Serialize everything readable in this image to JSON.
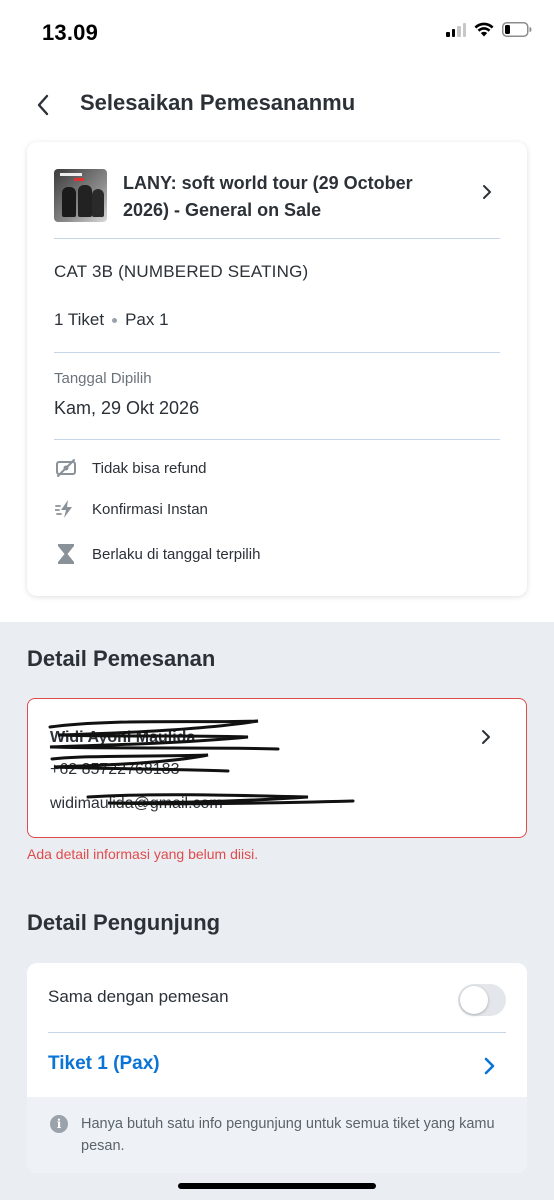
{
  "status_bar": {
    "time": "13.09"
  },
  "header": {
    "title": "Selesaikan Pemesananmu"
  },
  "event": {
    "title": "LANY: soft world tour (29 October 2026) - General on Sale",
    "category": "CAT 3B (NUMBERED SEATING)",
    "ticket_count": "1 Tiket",
    "pax": "Pax 1",
    "date_label": "Tanggal Dipilih",
    "date_value": "Kam, 29 Okt 2026",
    "features": [
      {
        "icon": "no-refund-icon",
        "label": "Tidak bisa refund"
      },
      {
        "icon": "instant-confirm-icon",
        "label": "Konfirmasi Instan"
      },
      {
        "icon": "hourglass-icon",
        "label": "Berlaku di tanggal terpilih"
      }
    ]
  },
  "booker": {
    "heading": "Detail Pemesanan",
    "name": "Widi Ayoni Maulida",
    "phone": "+62 85722768183",
    "email": "widimaulida@gmail.com",
    "error": "Ada detail informasi yang belum diisi.",
    "error_color": "#e04b4b"
  },
  "visitor": {
    "heading": "Detail Pengunjung",
    "same_as_booker_label": "Sama dengan pemesan",
    "same_as_booker_on": false,
    "ticket_label": "Tiket 1 (Pax)",
    "info": "Hanya butuh satu info pengunjung untuk semua tiket yang kamu pesan.",
    "accent_color": "#0a74d6"
  }
}
